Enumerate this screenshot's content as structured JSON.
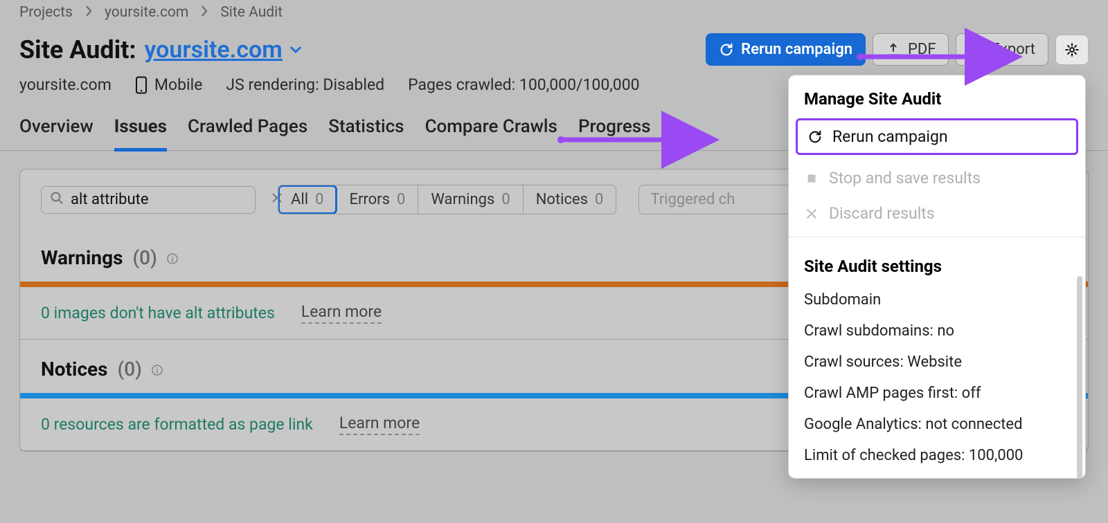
{
  "breadcrumbs": [
    "Projects",
    "yoursite.com",
    "Site Audit"
  ],
  "header": {
    "title_prefix": "Site Audit:",
    "site": "yoursite.com",
    "rerun_label": "Rerun campaign",
    "pdf_label": "PDF",
    "export_label": "Export"
  },
  "meta": {
    "domain": "yoursite.com",
    "device": "Mobile",
    "js": "JS rendering: Disabled",
    "pages": "Pages crawled: 100,000/100,000"
  },
  "tabs": [
    "Overview",
    "Issues",
    "Crawled Pages",
    "Statistics",
    "Compare Crawls",
    "Progress"
  ],
  "active_tab": "Issues",
  "search": {
    "value": "alt attribute"
  },
  "pills": {
    "all": {
      "label": "All",
      "count": "0"
    },
    "errors": {
      "label": "Errors",
      "count": "0"
    },
    "warnings": {
      "label": "Warnings",
      "count": "0"
    },
    "notices": {
      "label": "Notices",
      "count": "0"
    }
  },
  "triggered_placeholder": "Triggered ch",
  "sections": {
    "warnings": {
      "title": "Warnings",
      "count": "(0)",
      "row": "0 images don't have alt attributes",
      "learn": "Learn more"
    },
    "notices": {
      "title": "Notices",
      "count": "(0)",
      "row": "0 resources are formatted as page link",
      "learn": "Learn more"
    }
  },
  "popover": {
    "manage_title": "Manage Site Audit",
    "rerun": "Rerun campaign",
    "stop": "Stop and save results",
    "discard": "Discard results",
    "settings_title": "Site Audit settings",
    "lines": [
      "Subdomain",
      "Crawl subdomains: no",
      "Crawl sources: Website",
      "Crawl AMP pages first: off",
      "Google Analytics: not connected",
      "Limit of checked pages: 100,000"
    ]
  }
}
